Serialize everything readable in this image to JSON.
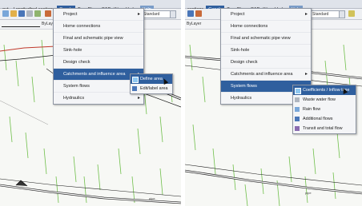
{
  "left_panel": {
    "menubar": [
      "out",
      "Longitudinal sections",
      "Canals",
      "TerraPlan",
      "CADutility",
      "Hydra",
      "Help"
    ],
    "active_menu": "Canals",
    "layer_combo": "ByLayer",
    "style_combo": "Standard",
    "canals_menu": [
      {
        "label": "Project",
        "has_submenu": true
      },
      {
        "label": "Home connections",
        "has_submenu": false
      },
      {
        "label": "Final and schematic pipe view",
        "has_submenu": false
      },
      {
        "label": "Sink-hole",
        "has_submenu": false
      },
      {
        "label": "Design check",
        "has_submenu": false
      },
      {
        "label": "Catchments and influence area",
        "has_submenu": true,
        "highlighted": true
      },
      {
        "label": "System flows",
        "has_submenu": true
      },
      {
        "label": "Hydraulics",
        "has_submenu": true
      }
    ],
    "submenu": [
      {
        "label": "Define area",
        "icon": "define-area-icon",
        "highlighted": true
      },
      {
        "label": "Edit/label area",
        "icon": "edit-label-area-icon"
      }
    ],
    "drawing_labels": [
      "pipe"
    ]
  },
  "right_panel": {
    "menubar": [
      "sections",
      "Canals",
      "TerraPlan",
      "CADutility",
      "Hydra",
      "Help"
    ],
    "active_menu": "Canals",
    "layer_combo": "ByLayer",
    "style_combo": "Standard",
    "canals_menu": [
      {
        "label": "Project",
        "has_submenu": true
      },
      {
        "label": "Home connections",
        "has_submenu": false
      },
      {
        "label": "Final and schematic pipe view",
        "has_submenu": false
      },
      {
        "label": "Sink-hole",
        "has_submenu": false
      },
      {
        "label": "Design check",
        "has_submenu": false
      },
      {
        "label": "Catchments and influence area",
        "has_submenu": true
      },
      {
        "label": "System flows",
        "has_submenu": true,
        "highlighted": true
      },
      {
        "label": "Hydraulics",
        "has_submenu": true
      }
    ],
    "submenu": [
      {
        "label": "Coefficients / Inflow time",
        "icon": "coefficients-icon",
        "highlighted": true
      },
      {
        "label": "Waste water flow",
        "icon": "waste-water-icon"
      },
      {
        "label": "Rain flow",
        "icon": "rain-flow-icon"
      },
      {
        "label": "Additional flows",
        "icon": "additional-flows-icon"
      },
      {
        "label": "Transit and total flow",
        "icon": "transit-flow-icon"
      }
    ],
    "drawing_labels": [
      "pipe"
    ]
  },
  "colors": {
    "menu_highlight": "#2f5f9e",
    "grass_green": "#6fbf4a",
    "pipe_black": "#1a1a1a",
    "pipe_red": "#c0392b",
    "drawing_bg": "#f7f8f5"
  }
}
